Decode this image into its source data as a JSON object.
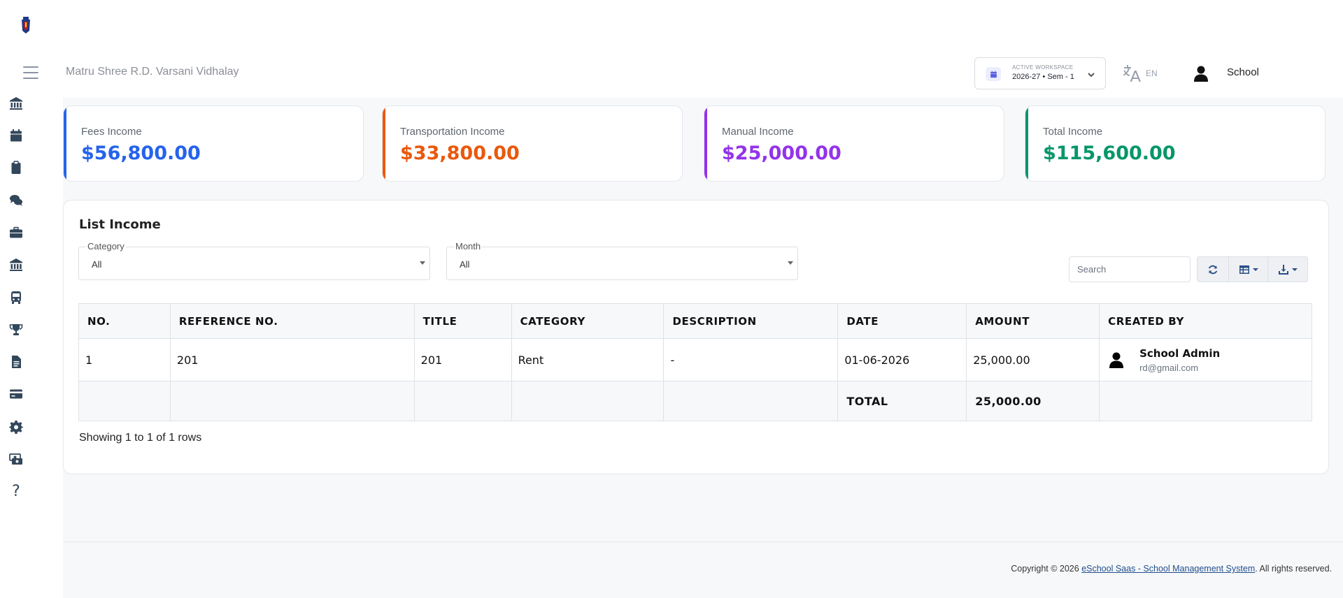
{
  "header": {
    "school_name": "Matru Shree R.D. Varsani Vidhalay",
    "workspace_label": "ACTIVE WORKSPACE",
    "workspace_value": "2026-27 • Sem - 1",
    "language": "EN",
    "user_name": "School"
  },
  "stats": [
    {
      "label": "Fees Income",
      "value": "$56,800.00",
      "color": "#2563eb"
    },
    {
      "label": "Transportation Income",
      "value": "$33,800.00",
      "color": "#ea580c"
    },
    {
      "label": "Manual Income",
      "value": "$25,000.00",
      "color": "#9333ea"
    },
    {
      "label": "Total Income",
      "value": "$115,600.00",
      "color": "#059669"
    }
  ],
  "list": {
    "title": "List Income",
    "category_label": "Category",
    "category_value": "All",
    "month_label": "Month",
    "month_value": "All",
    "search_placeholder": "Search",
    "columns": [
      "NO.",
      "REFERENCE NO.",
      "TITLE",
      "CATEGORY",
      "DESCRIPTION",
      "DATE",
      "AMOUNT",
      "CREATED BY"
    ],
    "rows": [
      {
        "no": "1",
        "reference": "201",
        "title": "201",
        "category": "Rent",
        "description": "-",
        "date": "01-06-2026",
        "amount": "25,000.00",
        "created_by_name": "School Admin",
        "created_by_email": "rd@gmail.com"
      }
    ],
    "total_label": "TOTAL",
    "total_value": "25,000.00",
    "showing": "Showing 1 to 1 of 1 rows"
  },
  "footer": {
    "prefix": "Copyright © 2026 ",
    "link": "eSchool Saas - School Management System",
    "suffix": ". All rights reserved."
  },
  "icons": {
    "sidebar": [
      "bank-icon",
      "calendar-icon",
      "clipboard-icon",
      "chat-icon",
      "briefcase-icon",
      "bank-icon",
      "bus-icon",
      "trophy-icon",
      "file-icon",
      "credit-card-icon",
      "gear-icon",
      "cash-icon",
      "help-icon"
    ]
  }
}
